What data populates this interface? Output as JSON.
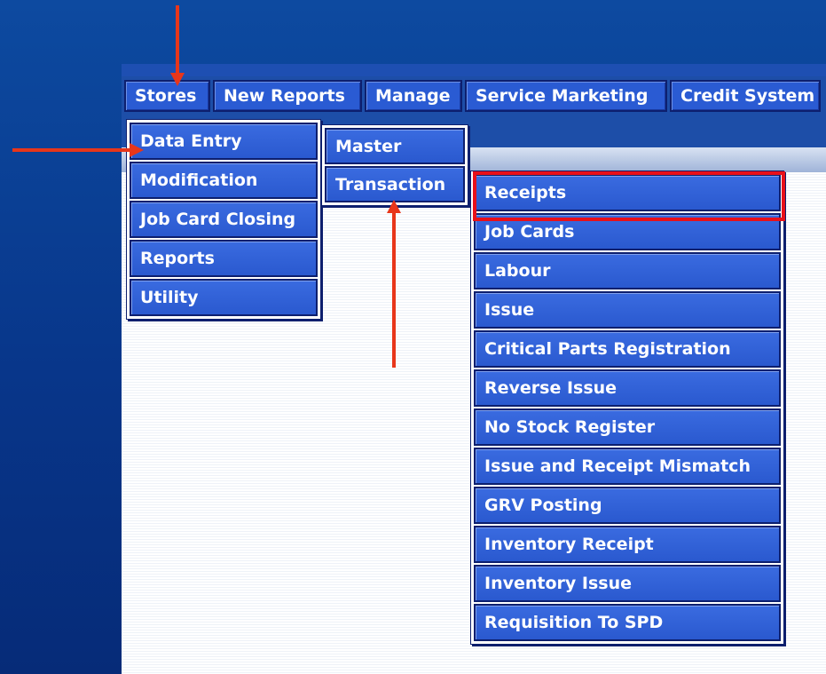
{
  "menubar": {
    "items": [
      "Stores",
      "New Reports",
      "Manage",
      "Service Marketing",
      "Credit System"
    ]
  },
  "stores_menu": {
    "items": [
      "Data Entry",
      "Modification",
      "Job Card Closing",
      "Reports",
      "Utility"
    ]
  },
  "data_entry_menu": {
    "items": [
      "Master",
      "Transaction"
    ]
  },
  "transaction_menu": {
    "items": [
      "Receipts",
      "Job Cards",
      "Labour",
      "Issue",
      "Critical Parts Registration",
      "Reverse Issue",
      "No Stock Register",
      "Issue and Receipt Mismatch",
      "GRV Posting",
      "Inventory Receipt",
      "Inventory Issue",
      "Requisition To SPD"
    ],
    "highlighted_item": "Receipts"
  },
  "annotations": {
    "arrow_color": "#e8361a",
    "highlight_color": "#e8101a"
  }
}
